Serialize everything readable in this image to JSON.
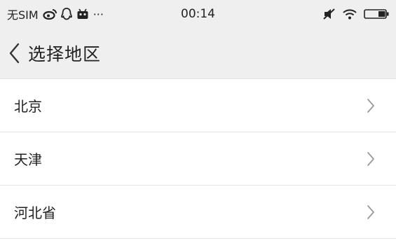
{
  "status_bar": {
    "carrier": "无SIM",
    "overflow": "···",
    "time": "00:14",
    "icons_left": [
      "weibo-icon",
      "qq-icon",
      "android-icon"
    ],
    "icons_right": [
      "mute-icon",
      "wifi-icon",
      "battery-icon"
    ]
  },
  "nav": {
    "title": "选择地区",
    "back_icon": "chevron-left-icon"
  },
  "regions": [
    {
      "label": "北京"
    },
    {
      "label": "天津"
    },
    {
      "label": "河北省"
    }
  ],
  "colors": {
    "bar_background": "#efefef",
    "list_background": "#ffffff",
    "divider": "#e6e6e6",
    "text": "#222222",
    "chevron": "#9a9a9a"
  }
}
